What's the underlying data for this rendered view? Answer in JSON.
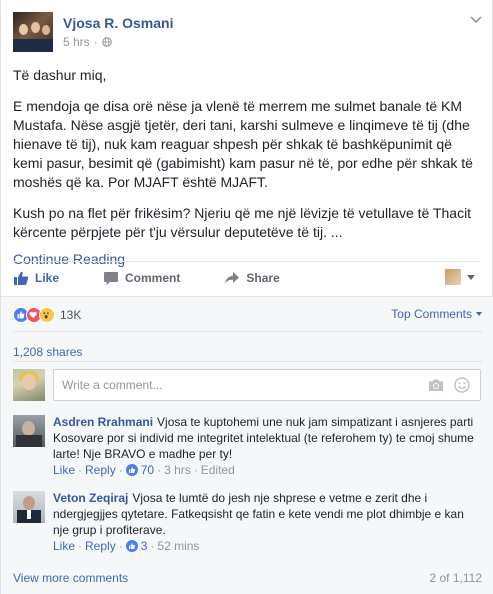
{
  "post": {
    "author": "Vjosa R. Osmani",
    "time": "5 hrs",
    "dot": "·",
    "paragraphs": [
      "Të dashur miq,",
      "E mendoja qe disa orë nëse ja vlenë të merrem me sulmet banale të KM Mustafa. Nëse asgjë tjetër, deri tani, karshi sulmeve e linqimeve të tij (dhe hienave të tij), nuk kam reaguar shpesh për shkak të bashkëpunimit që kemi pasur, besimit që (gabimisht) kam pasur në të, por edhe për shkak të moshës që ka. Por MJAFT është MJAFT.",
      "Kush po na flet për frikësim? Njeriu që me një lëvizje të vetullave të Thacit kërcente përpjete për t'ju vërsulur deputetëve të tij. ..."
    ],
    "continue_label": "Continue Reading"
  },
  "actions": {
    "like": "Like",
    "comment": "Comment",
    "share": "Share"
  },
  "reactions": {
    "count": "13K",
    "sort_label": "Top Comments",
    "shares": "1,208 shares"
  },
  "composer": {
    "placeholder": "Write a comment..."
  },
  "comments": [
    {
      "name": "Asdren Rrahmani",
      "text": "Vjosa te kuptohemi une nuk jam simpatizant i asnjeres parti Kosovare por si individ me integritet intelektual (te referohem ty) te cmoj shume larte! Nje BRAVO e madhe per ty!",
      "like": "Like",
      "reply": "Reply",
      "likes": "70",
      "time": "3 hrs",
      "edited": "Edited"
    },
    {
      "name": "Veton Zeqiraj",
      "text": "Vjosa te lumtë do jesh nje shprese e vetme e zerit dhe i ndergjegjjes qytetare. Fatkeqsisht qe fatin e kete vendi me plot dhimbje e kan nje grup i profiterave.",
      "like": "Like",
      "reply": "Reply",
      "likes": "3",
      "time": "52 mins",
      "edited": ""
    }
  ],
  "footer": {
    "view_more": "View more comments",
    "count": "2 of 1,112"
  },
  "colors": {
    "link": "#365899",
    "accent": "#4267b2",
    "muted": "#90949c"
  }
}
